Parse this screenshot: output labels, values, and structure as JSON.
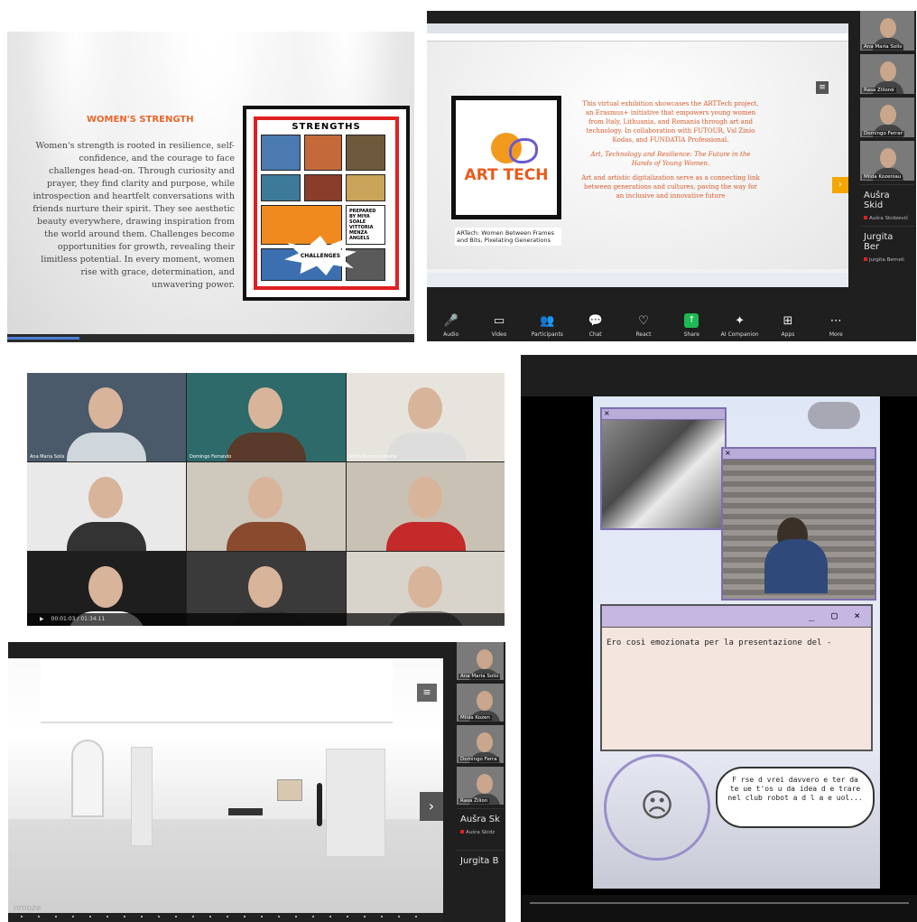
{
  "panel1": {
    "title": "WOMEN'S STRENGTH",
    "body": "Women's strength is rooted in resilience, self-confidence, and the courage to face challenges head-on. Through curiosity and prayer, they find clarity and purpose, while introspection and heartfelt conversations with friends nurture their spirit. They see aesthetic beauty everywhere, drawing inspiration from the world around them. Challenges become opportunities for growth, revealing their limitless potential. In every moment, women rise with grace, determination, and unwavering power.",
    "poster_title": "STRENGTHS",
    "poster_burst": "CHALLENGES",
    "poster_credit": "PREPARED BY MIYA SOALE VITTORIA MENZA ANGELS"
  },
  "panel2": {
    "logo_text": "ART TECH",
    "caption": "ARTech: Women Between Frames and Bits, Pixelating Generations",
    "para1": "This virtual exhibition showcases the ARTTech project, an Erasmus+ initiative that empowers young women from Italy, Lithuania, and Romania through art and technology. In collaboration with FUTOUR, Vsl Zinio Kodas, and FUNDATIA Professional.",
    "para2": "Art, Technology and Resilience: The Future in the Hands of Young Women.",
    "para3": "Art and artistic digitalization serve as a connecting link between generations and cultures, paving the way for an inclusive and innovative future",
    "toolbar": [
      {
        "icon": "microphone-icon",
        "glyph": "🎤",
        "label": "Audio"
      },
      {
        "icon": "video-icon",
        "glyph": "▭",
        "label": "Video"
      },
      {
        "icon": "participants-icon",
        "glyph": "👥",
        "label": "Participants"
      },
      {
        "icon": "chat-icon",
        "glyph": "💬",
        "label": "Chat"
      },
      {
        "icon": "react-icon",
        "glyph": "♡",
        "label": "React"
      },
      {
        "icon": "share-icon",
        "glyph": "↑",
        "label": "Share"
      },
      {
        "icon": "ai-companion-icon",
        "glyph": "✦",
        "label": "AI Companion"
      },
      {
        "icon": "apps-icon",
        "glyph": "⊞",
        "label": "Apps"
      },
      {
        "icon": "more-icon",
        "glyph": "⋯",
        "label": "More"
      }
    ],
    "participants": [
      {
        "name": "Ana Maria Solis"
      },
      {
        "name": "Rasa Zilionė"
      },
      {
        "name": "Domingo Ferrar"
      },
      {
        "name": "Milda Kozeniau"
      }
    ],
    "name_tiles": [
      {
        "name": "Aušra Skid",
        "sub": "Aušra Skidzevič"
      },
      {
        "name": "Jurgita Ber",
        "sub": "Jurgita Berneli"
      }
    ],
    "colors": {
      "accent": "#f5a600",
      "share": "#1db954"
    }
  },
  "panel3": {
    "tiles": [
      {
        "label": "Ana Maria Solis"
      },
      {
        "label": "Domingo Ferrando"
      },
      {
        "label": "Milda Kozeniauskaitė"
      },
      {
        "label": ""
      },
      {
        "label": ""
      },
      {
        "label": ""
      },
      {
        "label": ""
      },
      {
        "label": ""
      },
      {
        "label": ""
      }
    ],
    "time": "00:01:03 / 01:34:11"
  },
  "panel4": {
    "message": "Ero così emozionata per la presentazione del -",
    "bubble": "F rse d vrei davvero e ter da te ue t'os u da idea d e trare nel club robot a d l a e uol...",
    "window_controls": "_ ▢ ×"
  },
  "panel5": {
    "brand": "nmoze",
    "participants": [
      {
        "name": "Ana Maria Solis"
      },
      {
        "name": "Milda Kozen"
      },
      {
        "name": "Domingo Ferra"
      },
      {
        "name": "Rasa Žilion"
      }
    ],
    "name_tiles": [
      {
        "name": "Aušra Sk",
        "sub": "Aušra Skidz"
      },
      {
        "name": "Jurgita B",
        "sub": ""
      }
    ]
  }
}
